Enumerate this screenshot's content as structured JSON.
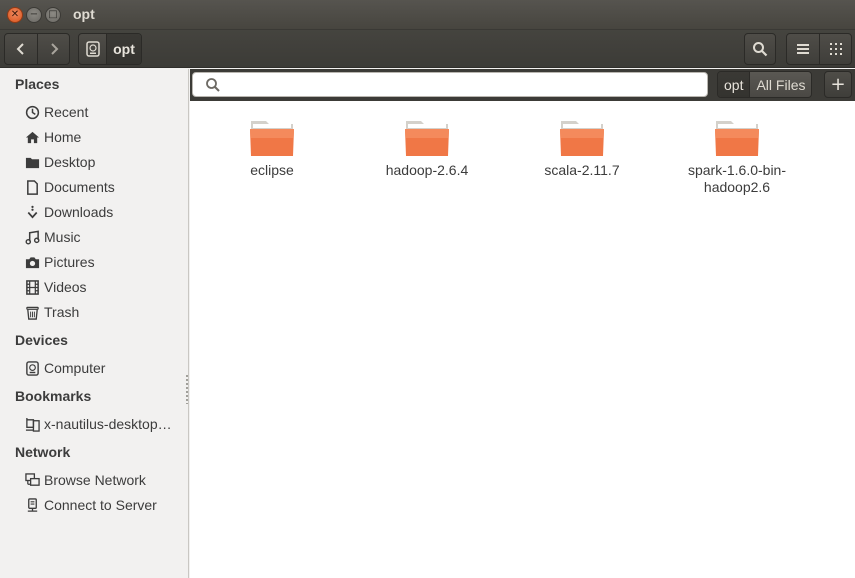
{
  "window": {
    "title": "opt"
  },
  "toolbar": {
    "path_crumb": "opt"
  },
  "search": {
    "value": "",
    "scope_current": "opt",
    "scope_all": "All Files"
  },
  "sidebar": {
    "places_header": "Places",
    "places": [
      {
        "label": "Recent",
        "icon": "clock-icon"
      },
      {
        "label": "Home",
        "icon": "home-icon"
      },
      {
        "label": "Desktop",
        "icon": "folder-icon"
      },
      {
        "label": "Documents",
        "icon": "document-icon"
      },
      {
        "label": "Downloads",
        "icon": "download-icon"
      },
      {
        "label": "Music",
        "icon": "music-icon"
      },
      {
        "label": "Pictures",
        "icon": "camera-icon"
      },
      {
        "label": "Videos",
        "icon": "film-icon"
      },
      {
        "label": "Trash",
        "icon": "trash-icon"
      }
    ],
    "devices_header": "Devices",
    "devices": [
      {
        "label": "Computer",
        "icon": "drive-icon"
      }
    ],
    "bookmarks_header": "Bookmarks",
    "bookmarks": [
      {
        "label": "x-nautilus-desktop…",
        "icon": "desktop-icon"
      }
    ],
    "network_header": "Network",
    "network": [
      {
        "label": "Browse Network",
        "icon": "network-icon"
      },
      {
        "label": "Connect to Server",
        "icon": "server-icon"
      }
    ]
  },
  "files": [
    {
      "name": "eclipse"
    },
    {
      "name": "hadoop-2.6.4"
    },
    {
      "name": "scala-2.11.7"
    },
    {
      "name": "spark-1.6.0-bin-hadoop2.6"
    }
  ],
  "colors": {
    "accent": "#e95420",
    "folder": "#f07746",
    "toolbar": "#3c3b37"
  }
}
